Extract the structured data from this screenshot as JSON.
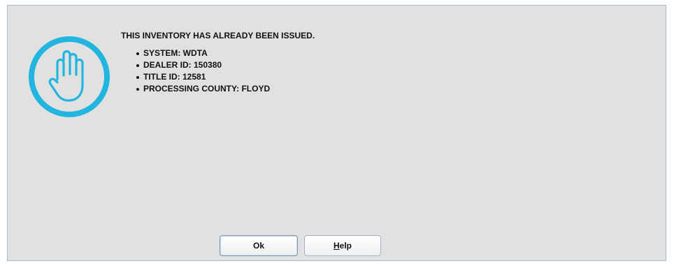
{
  "dialog": {
    "icon": "stop-hand-icon",
    "accent_color": "#22b5e0",
    "message": "THIS INVENTORY HAS ALREADY BEEN ISSUED.",
    "details": [
      "SYSTEM:  WDTA",
      "DEALER ID: 150380",
      "TITLE ID: 12581",
      "PROCESSING COUNTY: FLOYD"
    ],
    "buttons": {
      "ok_label": "Ok",
      "help_mnemonic": "H",
      "help_rest": "elp"
    }
  }
}
